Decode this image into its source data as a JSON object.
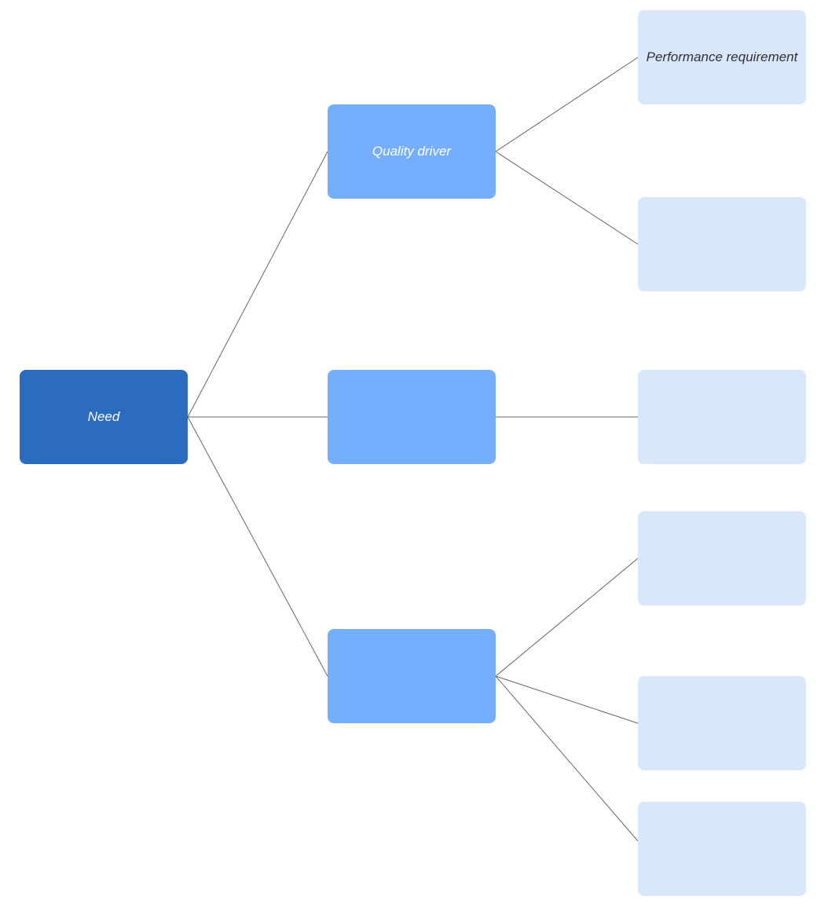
{
  "colors": {
    "level1_bg": "#2c6cbf",
    "level2_bg": "#74aefc",
    "level3_bg": "#d9e7fd",
    "connector": "#666666"
  },
  "nodes": {
    "root": {
      "label": "Need"
    },
    "driver_a": {
      "label": "Quality driver"
    },
    "driver_b": {
      "label": ""
    },
    "driver_c": {
      "label": ""
    },
    "req_a1": {
      "label": "Performance requirement"
    },
    "req_a2": {
      "label": ""
    },
    "req_b1": {
      "label": ""
    },
    "req_c1": {
      "label": ""
    },
    "req_c2": {
      "label": ""
    },
    "req_c3": {
      "label": ""
    }
  }
}
